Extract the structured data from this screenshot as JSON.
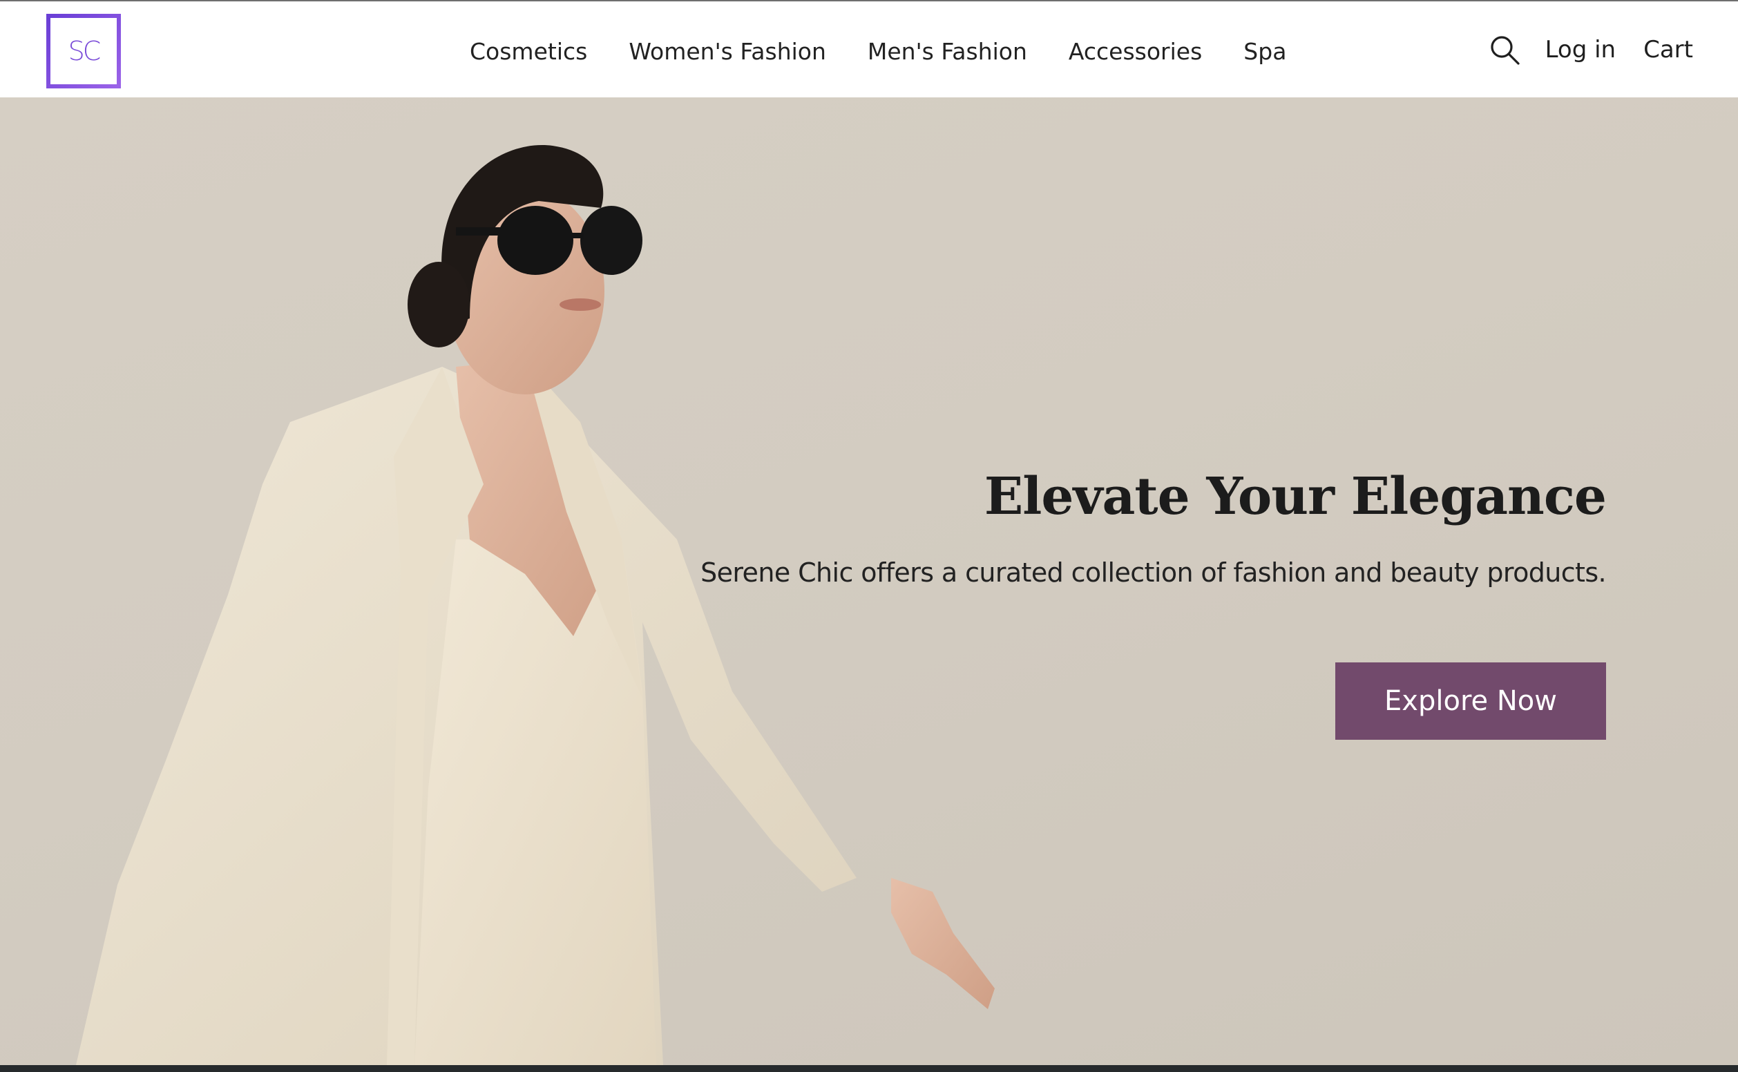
{
  "brand": {
    "logo_text": "SC",
    "logo_color": "#7a4bd8"
  },
  "nav": {
    "items": [
      {
        "label": "Cosmetics"
      },
      {
        "label": "Women's Fashion"
      },
      {
        "label": "Men's Fashion"
      },
      {
        "label": "Accessories"
      },
      {
        "label": "Spa"
      }
    ]
  },
  "header_actions": {
    "search_icon": "search-icon",
    "login_label": "Log in",
    "cart_label": "Cart"
  },
  "hero": {
    "title": "Elevate Your Elegance",
    "subtitle": "Serene Chic offers a curated collection of fashion and beauty products.",
    "cta_label": "Explore Now",
    "cta_color": "#724a6c",
    "background_color": "#d3ccc1"
  }
}
